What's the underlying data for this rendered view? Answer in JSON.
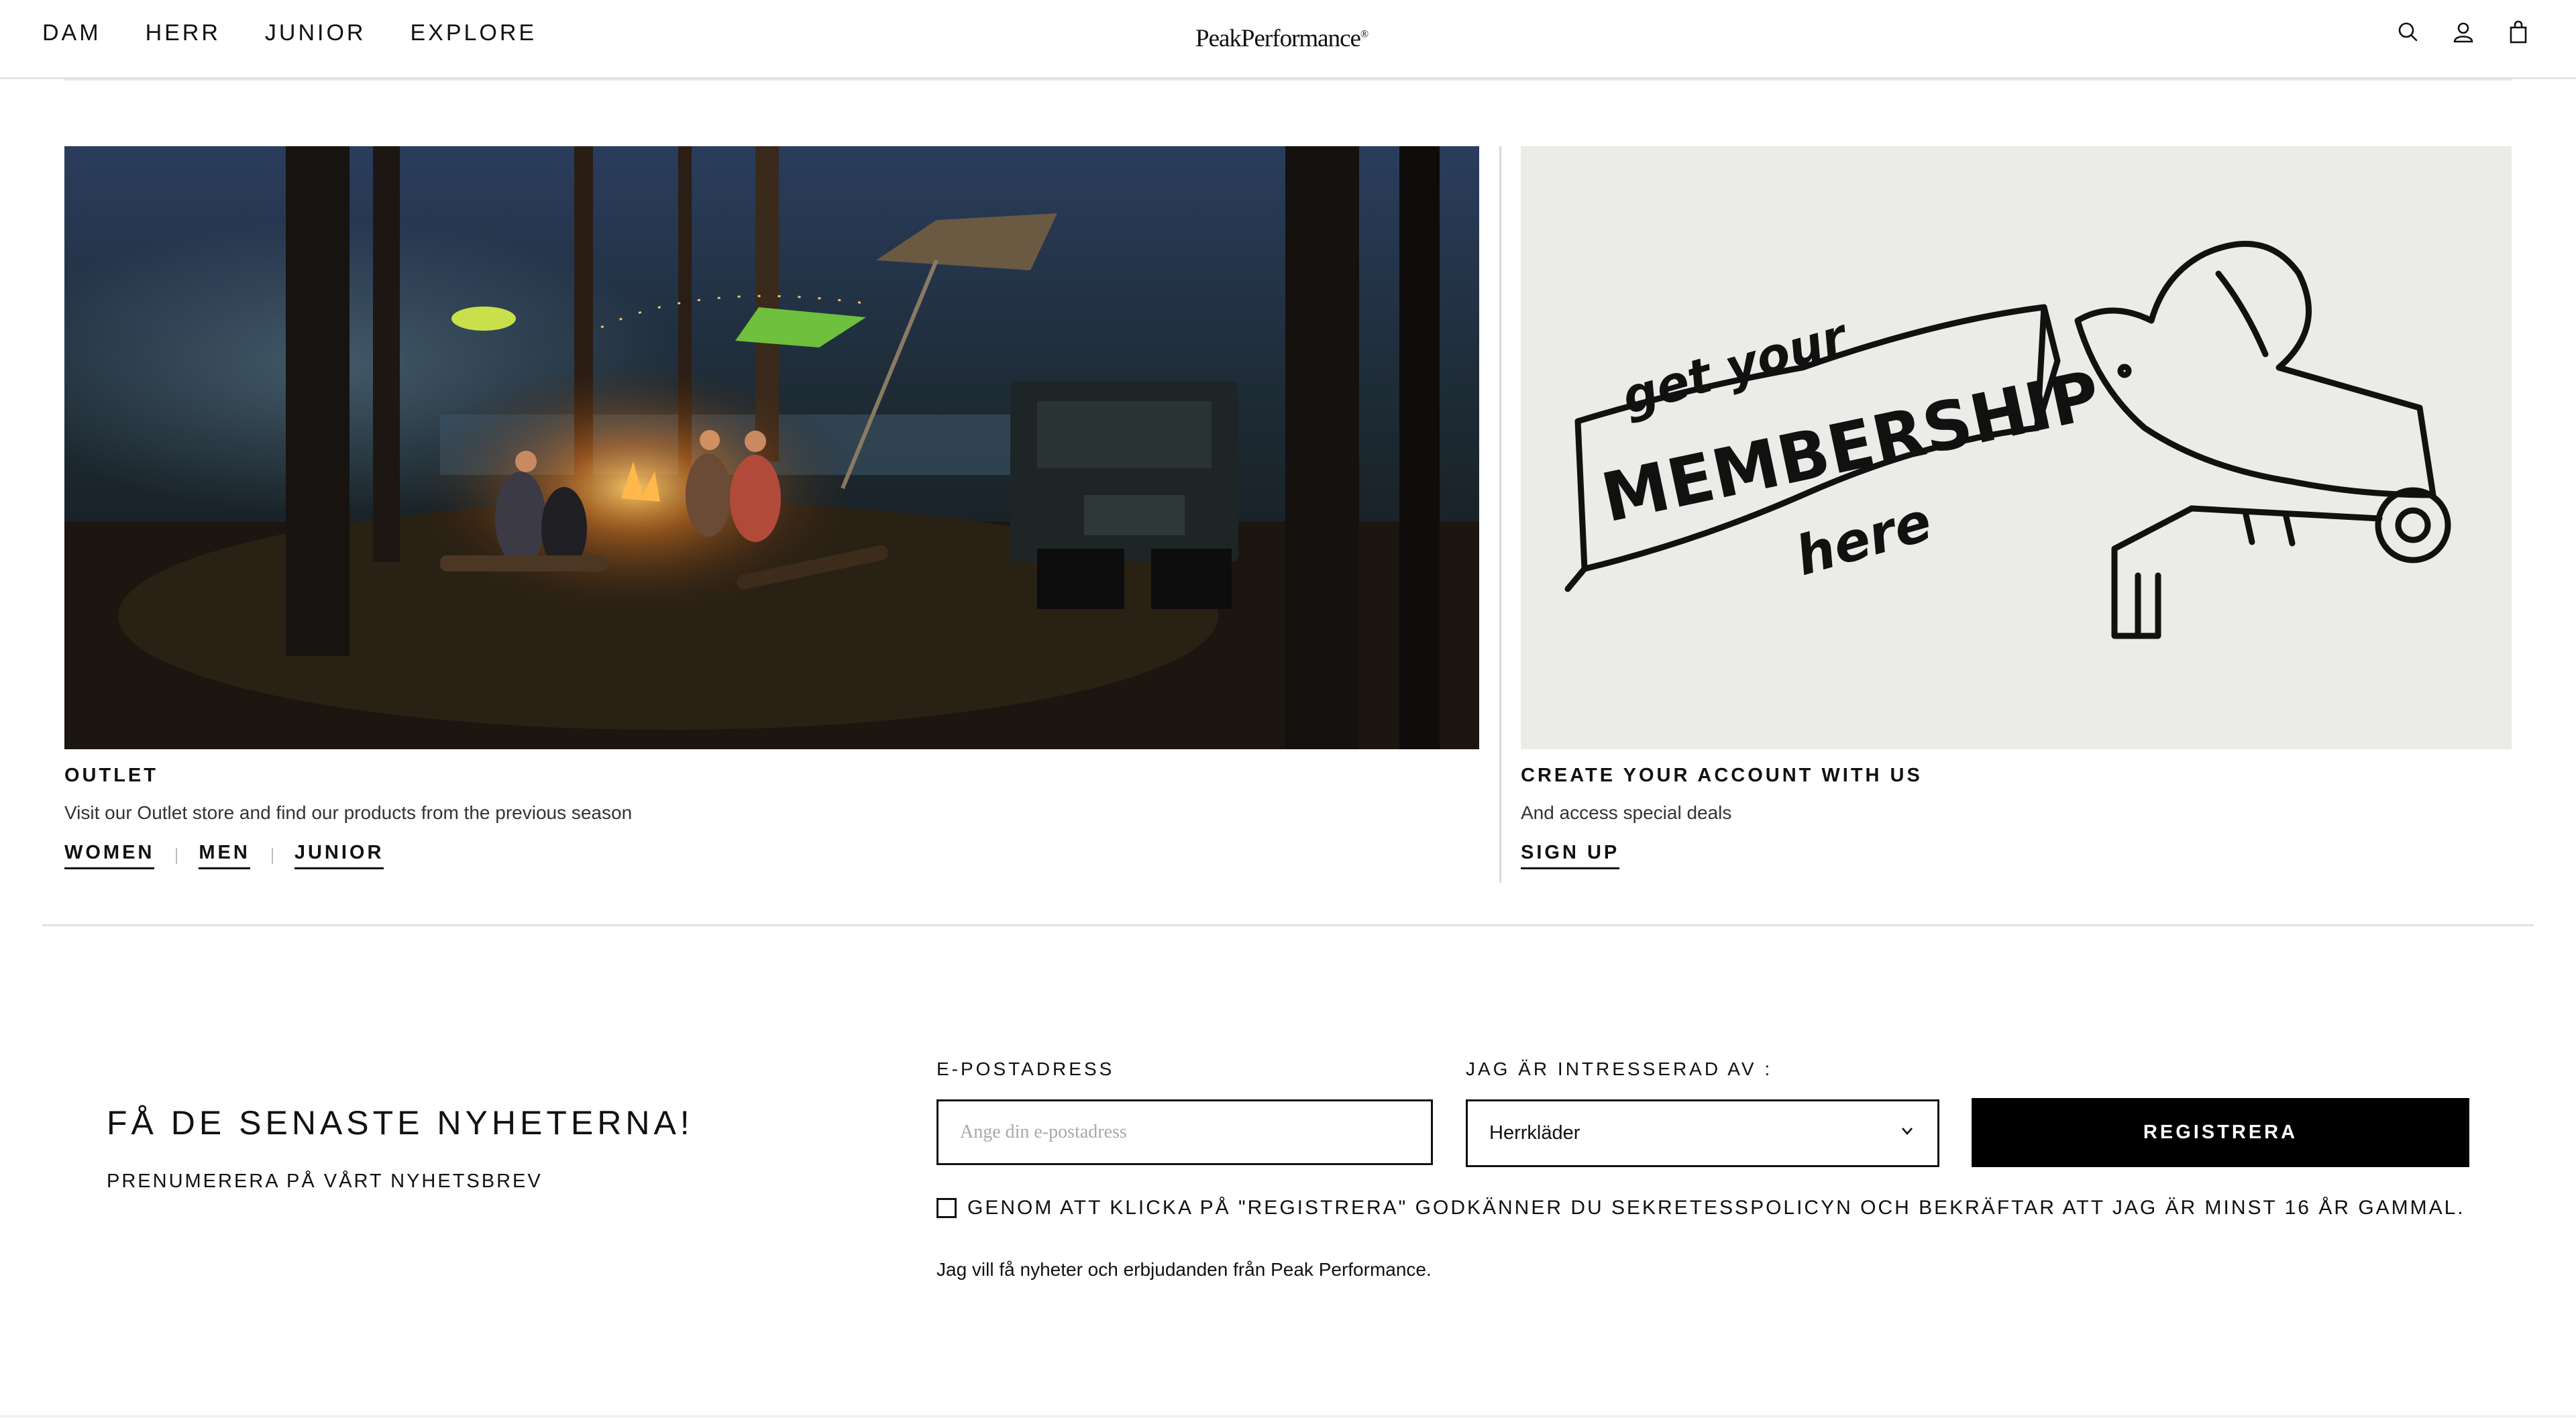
{
  "header": {
    "nav": [
      "DAM",
      "HERR",
      "JUNIOR",
      "EXPLORE"
    ],
    "logo": "PeakPerformance",
    "logo_mark": "®",
    "icons": [
      "search-icon",
      "account-icon",
      "bag-icon"
    ]
  },
  "outlet": {
    "title": "OUTLET",
    "description": "Visit our Outlet store and find our products from the previous season",
    "links": [
      "WOMEN",
      "MEN",
      "JUNIOR"
    ]
  },
  "membership": {
    "art_text": [
      "get your",
      "MEMBERSHIP",
      "here"
    ],
    "title": "CREATE YOUR ACCOUNT WITH US",
    "description": "And access special deals",
    "cta": "SIGN UP"
  },
  "newsletter": {
    "title": "FÅ DE SENASTE NYHETERNA!",
    "subtitle": "PRENUMERERA PÅ VÅRT NYHETSBREV",
    "email_label": "E-POSTADRESS",
    "email_placeholder": "Ange din e-postadress",
    "email_value": "",
    "interest_label": "JAG ÄR INTRESSERAD AV :",
    "interest_value": "Herrkläder",
    "register_label": "REGISTRERA",
    "consent_text": "GENOM ATT KLICKA PÅ \"REGISTRERA\" GODKÄNNER DU SEKRETESSPOLICYN OCH BEKRÄFTAR ATT JAG ÄR MINST 16 ÅR GAMMAL.",
    "consent_checked": false,
    "note": "Jag vill få nyheter och erbjudanden från Peak Performance."
  },
  "colors": {
    "text": "#111111",
    "button_bg": "#000000",
    "membership_bg": "#EBEBE7"
  }
}
